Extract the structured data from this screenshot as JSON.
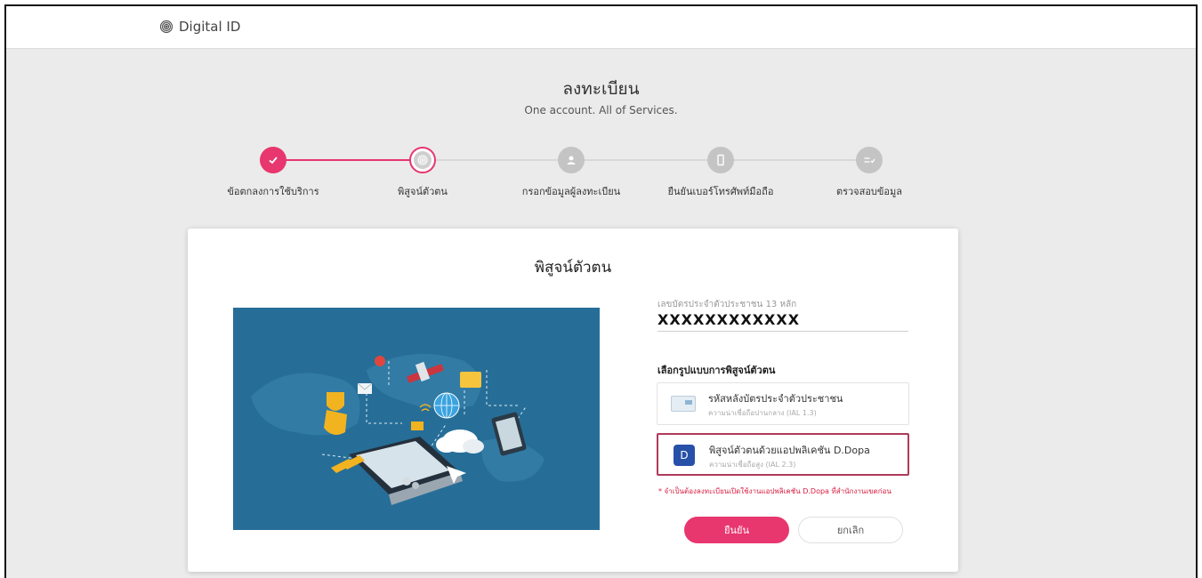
{
  "brand": {
    "name": "Digital ID",
    "icon": "fingerprint-icon"
  },
  "page": {
    "title": "ลงทะเบียน",
    "subtitle": "One account. All of Services."
  },
  "steps": [
    {
      "label": "ข้อตกลงการใช้บริการ",
      "status": "done",
      "icon": "check-icon"
    },
    {
      "label": "พิสูจน์ตัวตน",
      "status": "current",
      "icon": "fingerprint-icon"
    },
    {
      "label": "กรอกข้อมูลผู้ลงทะเบียน",
      "status": "todo",
      "icon": "person-icon"
    },
    {
      "label": "ยืนยันเบอร์โทรศัพท์มือถือ",
      "status": "todo",
      "icon": "phone-icon"
    },
    {
      "label": "ตรวจสอบข้อมูล",
      "status": "todo",
      "icon": "list-check-icon"
    }
  ],
  "card": {
    "title": "พิสูจน์ตัวตน",
    "id_field": {
      "label": "เลขบัตรประจำตัวประชาชน 13 หลัก",
      "value": "XXXXXXXXXXXX"
    },
    "method_label": "เลือกรูปแบบการพิสูจน์ตัวตน",
    "options": [
      {
        "title": "รหัสหลังบัตรประจำตัวประชาชน",
        "subtitle": "ความน่าเชื่อถือปานกลาง (IAL 1.3)",
        "selected": false
      },
      {
        "title": "พิสูจน์ตัวตนด้วยแอปพลิเคชัน D.Dopa",
        "subtitle": "ความน่าเชื่อถือสูง (IAL 2.3)",
        "selected": true,
        "icon_letter": "D"
      }
    ],
    "warning": "* จำเป็นต้องลงทะเบียนเปิดใช้งานแอปพลิเคชัน D.Dopa ที่สำนักงานเขตก่อน",
    "confirm_label": "ยืนยัน",
    "cancel_label": "ยกเลิก"
  },
  "colors": {
    "accent": "#e8366f",
    "selected_border": "#b03a5b",
    "warning": "#d81c3f",
    "illustration_bg": "#266e98"
  }
}
